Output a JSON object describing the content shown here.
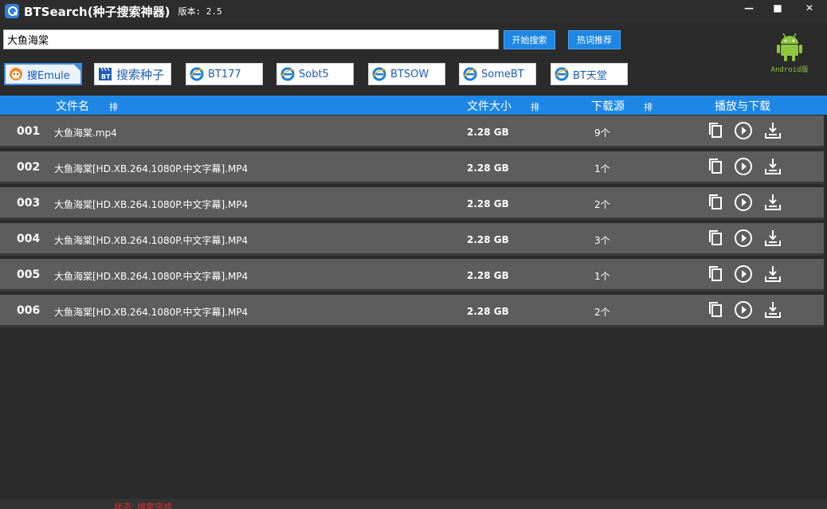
{
  "window": {
    "title": "BTSearch(种子搜索神器)",
    "version": "版本: 2.5",
    "minimize": "—",
    "maximize": "■",
    "close": "✕"
  },
  "search": {
    "query": "大鱼海棠",
    "start_label": "开始搜索",
    "hot_label": "热词推荐"
  },
  "android": {
    "label": "Android版",
    "color": "#8dc63f"
  },
  "sources": [
    {
      "label": "搜Emule",
      "icon": "emule-icon"
    },
    {
      "label": "搜索种子",
      "icon": "bt-clapper-icon"
    },
    {
      "label": "BT177",
      "icon": "ie-icon"
    },
    {
      "label": "Sobt5",
      "icon": "ie-icon"
    },
    {
      "label": "BTSOW",
      "icon": "ie-icon"
    },
    {
      "label": "SomeBT",
      "icon": "ie-icon"
    },
    {
      "label": "BT天堂",
      "icon": "ie-icon"
    }
  ],
  "table": {
    "headers": {
      "name": "文件名",
      "size": "文件大小",
      "sources": "下载源",
      "actions": "播放与下载",
      "sort": "排"
    },
    "rows": [
      {
        "num": "001",
        "name": "大鱼海棠.mp4",
        "size": "2.28 GB",
        "sources": "9个"
      },
      {
        "num": "002",
        "name": "大鱼海棠[HD.XB.264.1080P.中文字幕].MP4",
        "size": "2.28 GB",
        "sources": "1个"
      },
      {
        "num": "003",
        "name": "大鱼海棠[HD.XB.264.1080P.中文字幕].MP4",
        "size": "2.28 GB",
        "sources": "2个"
      },
      {
        "num": "004",
        "name": "大鱼海棠[HD.XB.264.1080P.中文字幕].MP4",
        "size": "2.28 GB",
        "sources": "3个"
      },
      {
        "num": "005",
        "name": "大鱼海棠[HD.XB.264.1080P.中文字幕].MP4",
        "size": "2.28 GB",
        "sources": "1个"
      },
      {
        "num": "006",
        "name": "大鱼海棠[HD.XB.264.1080P.中文字幕].MP4",
        "size": "2.28 GB",
        "sources": "2个"
      }
    ]
  },
  "status": {
    "text": "状态: 搜索完成"
  },
  "colors": {
    "accent": "#1e87e5",
    "row_bg": "#5d5d5d",
    "background": "#2b2b2b",
    "status": "#e03030"
  }
}
